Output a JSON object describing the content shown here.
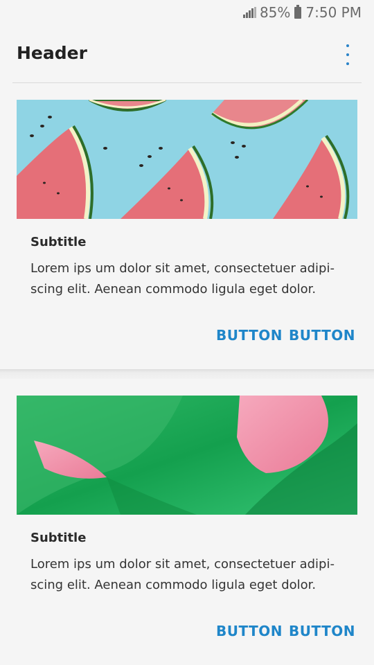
{
  "status_bar": {
    "battery_percent": "85%",
    "time": "7:50 PM",
    "icons": [
      "signal-icon",
      "battery-icon"
    ]
  },
  "header": {
    "title": "Header",
    "menu_icon": "more-vertical-icon"
  },
  "cards": [
    {
      "image": "watermelon-slices-photo",
      "subtitle": "Subtitle",
      "body_line1": "Lorem ips um dolor sit amet, consectetuer adipi-",
      "body_line2": "scing elit. Aenean commodo ligula eget dolor.",
      "button1": "BUTTON",
      "button2": "BUTTON"
    },
    {
      "image": "green-pink-abstract-photo",
      "subtitle": "Subtitle",
      "body_line1": "Lorem ips um dolor sit amet, consectetuer adipi-",
      "body_line2": "scing elit. Aenean commodo ligula eget dolor.",
      "button1": "BUTTON",
      "button2": "BUTTON"
    }
  ],
  "colors": {
    "accent": "#1f86c9",
    "background": "#f5f5f5"
  }
}
